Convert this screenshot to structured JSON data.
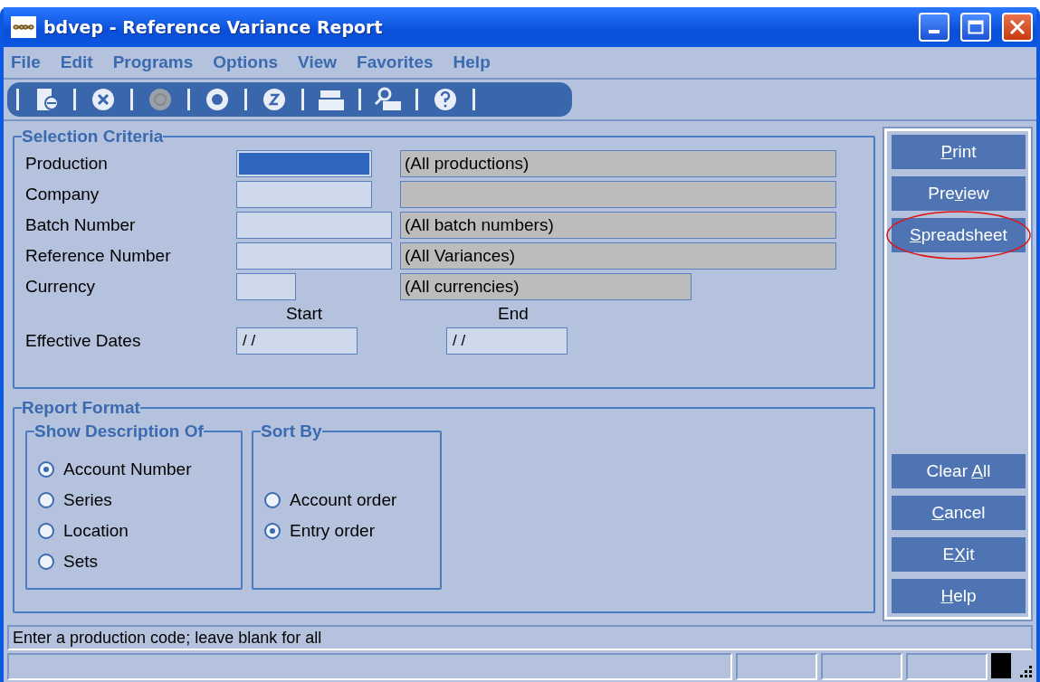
{
  "window": {
    "title": "bdvep - Reference Variance Report"
  },
  "menu": [
    "File",
    "Edit",
    "Programs",
    "Options",
    "View",
    "Favorites",
    "Help"
  ],
  "toolbar": [
    {
      "disabled": false
    },
    {
      "disabled": false
    },
    {
      "disabled": true
    },
    {
      "disabled": false
    },
    {
      "disabled": false
    },
    {
      "disabled": false
    },
    {
      "disabled": false
    },
    {
      "disabled": false
    }
  ],
  "selection_criteria": {
    "title": "Selection Criteria",
    "rows": [
      {
        "label": "Production",
        "focused": true,
        "description": "(All productions)"
      },
      {
        "label": "Company",
        "focused": false
      },
      {
        "label": "Batch Number",
        "focused": false,
        "description": "(All batch numbers)"
      },
      {
        "label": "Reference Number",
        "focused": false,
        "description": "(All Variances)"
      },
      {
        "label": "Currency",
        "focused": false,
        "description": "(All currencies)"
      }
    ],
    "date_headers": [
      "Start",
      "End"
    ],
    "effective_dates": {
      "label": "Effective Dates",
      "start": "/ /",
      "end": "/ /"
    }
  },
  "report_format": {
    "title": "Report Format",
    "show_description_of": {
      "title": "Show Description Of",
      "options": [
        {
          "label": "Account Number",
          "selected": true
        },
        {
          "label": "Series",
          "selected": false
        },
        {
          "label": "Location",
          "selected": false
        },
        {
          "label": "Sets",
          "selected": false
        }
      ]
    },
    "sort_by": {
      "title": "Sort By",
      "options": [
        {
          "label": "Account order",
          "selected": false
        },
        {
          "label": "Entry order",
          "selected": true
        }
      ]
    }
  },
  "actions_top": [
    {
      "key": "P",
      "post": "rint",
      "highlighted": false
    },
    {
      "pre": "Pre",
      "key": "v",
      "post": "iew",
      "highlighted": false
    },
    {
      "key": "S",
      "post": "preadsheet",
      "highlighted": true
    }
  ],
  "actions_bottom": [
    {
      "pre": "Clear ",
      "key": "A",
      "post": "ll",
      "highlighted": false
    },
    {
      "key": "C",
      "post": "ancel",
      "highlighted": false
    },
    {
      "pre": "E",
      "key": "X",
      "post": "it",
      "highlighted": false
    },
    {
      "key": "H",
      "post": "elp",
      "highlighted": false
    }
  ],
  "status_bar": {
    "message": "Enter a production code; leave blank for all"
  }
}
